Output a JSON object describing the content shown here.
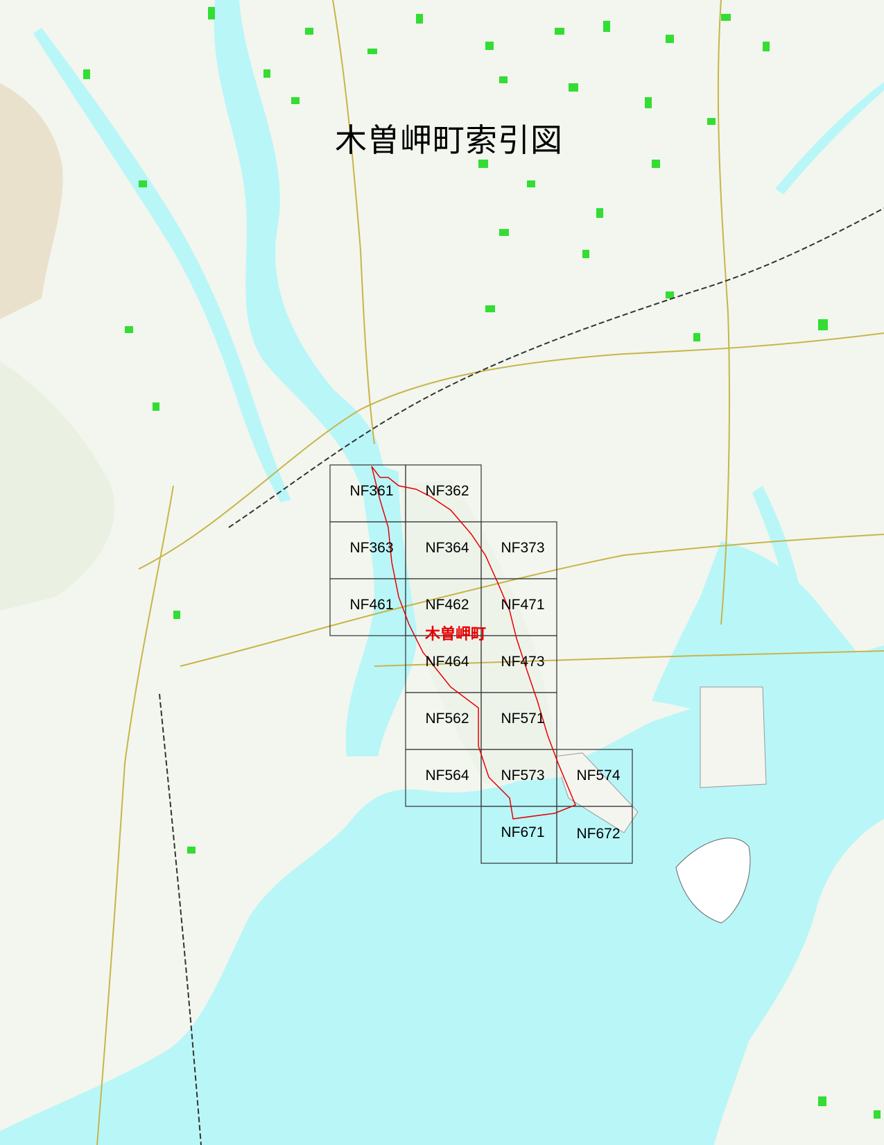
{
  "title": "木曽岬町索引図",
  "town_name": "木曽岬町",
  "colors": {
    "land": "#f2f6ee",
    "water": "#b9f6f8",
    "forest": "#33dd33",
    "roads": "#c8b44a",
    "grid": "#333333",
    "boundary": "#e60000",
    "title": "#000000"
  },
  "sheets": [
    {
      "id": "NF361",
      "label": "NF361"
    },
    {
      "id": "NF362",
      "label": "NF362"
    },
    {
      "id": "NF363",
      "label": "NF363"
    },
    {
      "id": "NF364",
      "label": "NF364"
    },
    {
      "id": "NF373",
      "label": "NF373"
    },
    {
      "id": "NF461",
      "label": "NF461"
    },
    {
      "id": "NF462",
      "label": "NF462"
    },
    {
      "id": "NF471",
      "label": "NF471"
    },
    {
      "id": "NF464",
      "label": "NF464"
    },
    {
      "id": "NF473",
      "label": "NF473"
    },
    {
      "id": "NF562",
      "label": "NF562"
    },
    {
      "id": "NF571",
      "label": "NF571"
    },
    {
      "id": "NF564",
      "label": "NF564"
    },
    {
      "id": "NF573",
      "label": "NF573"
    },
    {
      "id": "NF574",
      "label": "NF574"
    },
    {
      "id": "NF671",
      "label": "NF671"
    },
    {
      "id": "NF672",
      "label": "NF672"
    }
  ]
}
